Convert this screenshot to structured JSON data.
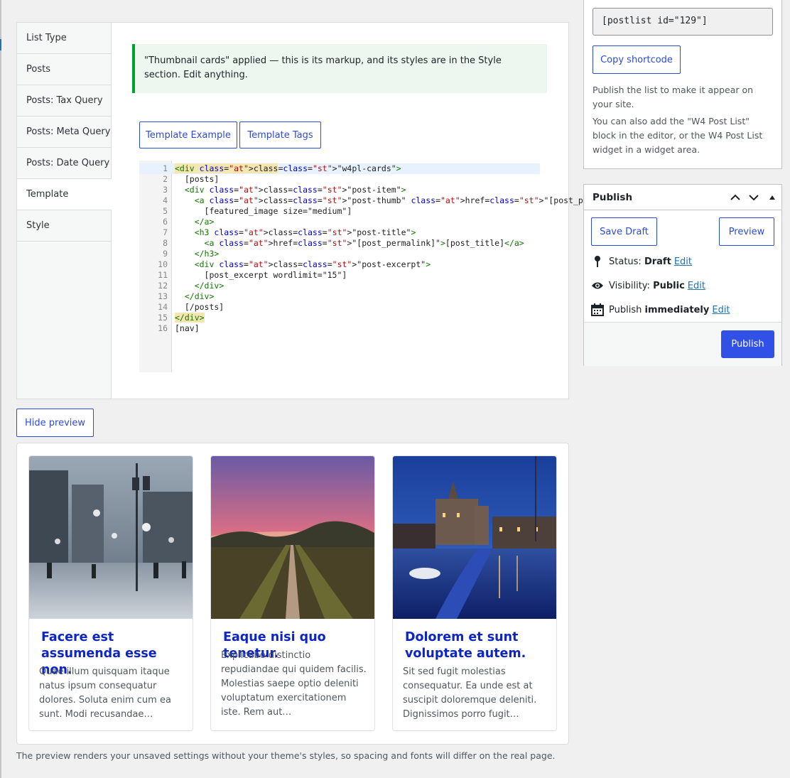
{
  "settings": {
    "tabs": [
      {
        "label": "List Type"
      },
      {
        "label": "Posts"
      },
      {
        "label": "Posts: Tax Query"
      },
      {
        "label": "Posts: Meta Query"
      },
      {
        "label": "Posts: Date Query"
      },
      {
        "label": "Template"
      },
      {
        "label": "Style"
      }
    ],
    "active_tab": "Template",
    "notice": "\"Thumbnail cards\" applied — this is its markup, and its styles are in the Style section. Edit anything.",
    "template_example_label": "Template Example",
    "template_tags_label": "Template Tags",
    "code_lines": [
      "<div class=\"w4pl-cards\">",
      "  [posts]",
      "  <div class=\"post-item\">",
      "    <a class=\"post-thumb\" href=\"[post_permalink]\">",
      "      [featured_image size=\"medium\"]",
      "    </a>",
      "    <h3 class=\"post-title\">",
      "      <a href=\"[post_permalink]\">[post_title]</a>",
      "    </h3>",
      "    <div class=\"post-excerpt\">",
      "      [post_excerpt wordlimit=\"15\"]",
      "    </div>",
      "  </div>",
      "  [/posts]",
      "</div>",
      "[nav]"
    ]
  },
  "hide_preview_label": "Hide preview",
  "preview": {
    "cards": [
      {
        "image": "snowy-city-street-photo",
        "title": "Facere est assumenda esse non.",
        "excerpt": "Quae illum quisquam itaque natus ipsum consequatur dolores. Soluta enim cum ea sunt. Modi recusandae…"
      },
      {
        "image": "misty-sunset-path-photo",
        "title": "Eaque nisi quo tenetur.",
        "excerpt": "Explicabo distinctio repudiandae qui quidem facilis. Molestias saepe optio deleniti voluptatum exercitationem iste. Rem aut…"
      },
      {
        "image": "canal-city-night-photo",
        "title": "Dolorem et sunt voluptate autem.",
        "excerpt": "Sit sed fugit molestias consequatur. Ea unde est at suscipit doloremque deleniti. Dignissimos porro fugit…"
      }
    ],
    "note": "The preview renders your unsaved settings without your theme's styles, so spacing and fonts will differ on the real page."
  },
  "shortcode": {
    "value": "[postlist id=\"129\"]",
    "copy_label": "Copy shortcode",
    "help1": "Publish the list to make it appear on your site.",
    "help2": "You can also add the \"W4 Post List\" block in the editor, or the W4 Post List widget in a widget area."
  },
  "publish": {
    "title": "Publish",
    "save_draft": "Save Draft",
    "preview": "Preview",
    "status_label": "Status:",
    "status_value": "Draft",
    "visibility_label": "Visibility:",
    "visibility_value": "Public",
    "publish_label": "Publish",
    "publish_value": "immediately",
    "edit": "Edit",
    "publish_button": "Publish"
  },
  "colors": {
    "accent": "#2c4bd8",
    "publish_button": "#3150e6",
    "notice_border": "#00a32a",
    "title_link": "#0d25c7"
  }
}
